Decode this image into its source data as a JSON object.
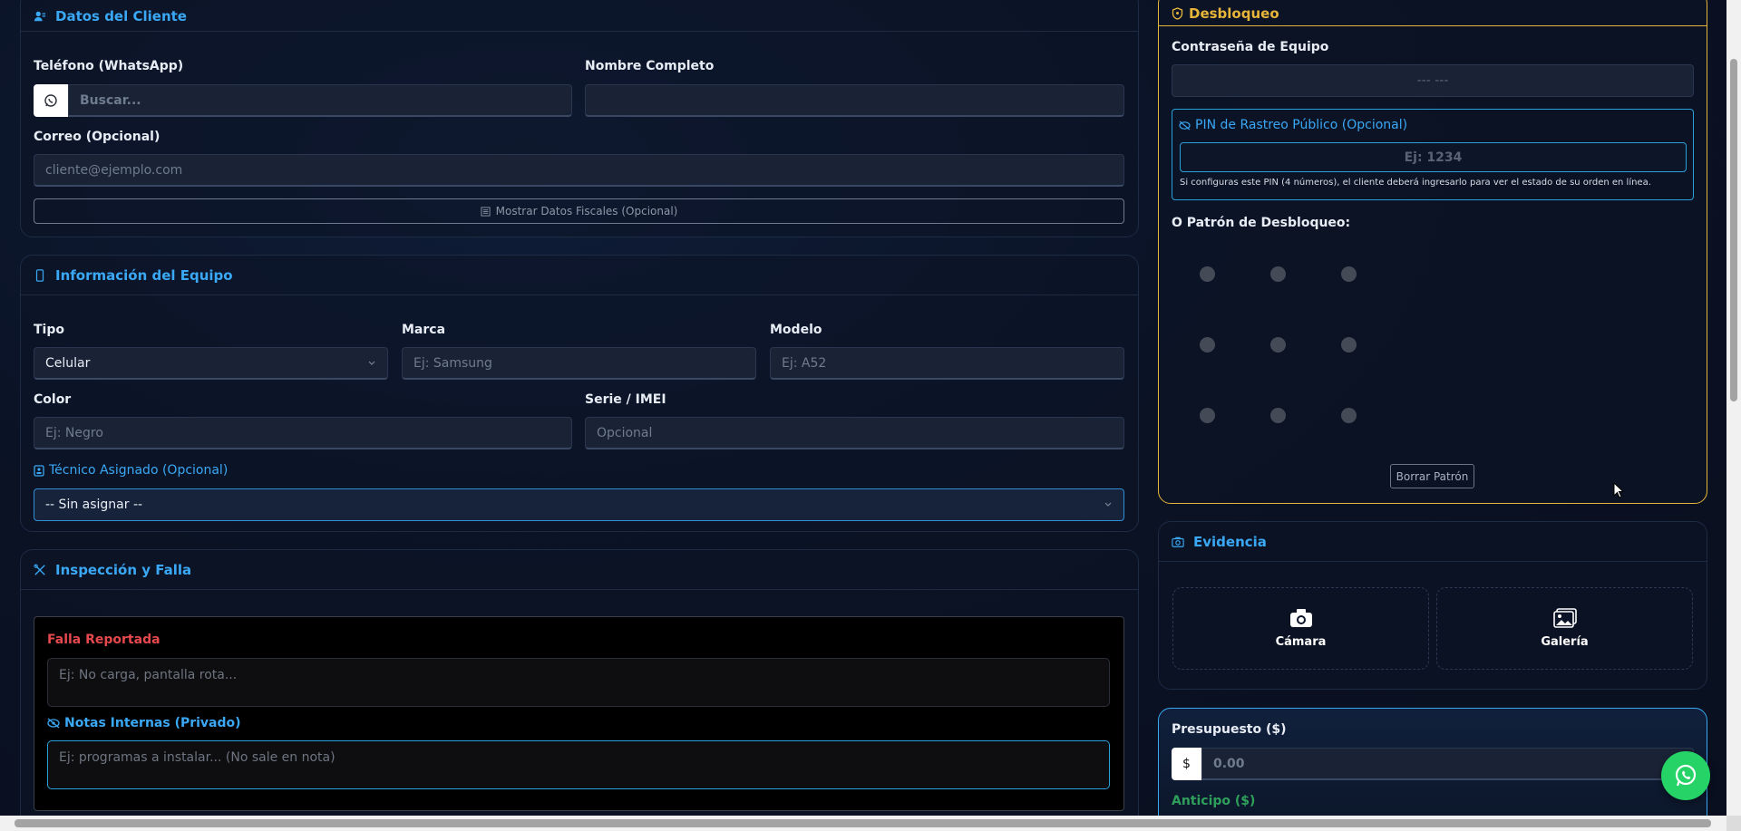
{
  "cliente": {
    "title": "Datos del Cliente",
    "telefono_label": "Teléfono (WhatsApp)",
    "telefono_placeholder": "Buscar...",
    "nombre_label": "Nombre Completo",
    "correo_label": "Correo (Opcional)",
    "correo_placeholder": "cliente@ejemplo.com",
    "fiscales_button": "Mostrar Datos Fiscales (Opcional)"
  },
  "equipo": {
    "title": "Información del Equipo",
    "tipo_label": "Tipo",
    "tipo_value": "Celular",
    "marca_label": "Marca",
    "marca_placeholder": "Ej: Samsung",
    "modelo_label": "Modelo",
    "modelo_placeholder": "Ej: A52",
    "color_label": "Color",
    "color_placeholder": "Ej: Negro",
    "serie_label": "Serie / IMEI",
    "serie_placeholder": "Opcional",
    "tecnico_label": "Técnico Asignado (Opcional)",
    "tecnico_value": "-- Sin asignar --"
  },
  "inspeccion": {
    "title": "Inspección y Falla",
    "falla_label": "Falla Reportada",
    "falla_placeholder": "Ej: No carga, pantalla rota...",
    "notas_label": "Notas Internas (Privado)",
    "notas_placeholder": "Ej: programas a instalar... (No sale en nota)"
  },
  "desbloqueo": {
    "title": "Desbloqueo",
    "contrasena_label": "Contraseña de Equipo",
    "contrasena_placeholder": "--- ---",
    "pin_label": "PIN de Rastreo Público (Opcional)",
    "pin_placeholder": "Ej: 1234",
    "pin_help": "Si configuras este PIN (4 números), el cliente deberá ingresarlo para ver el estado de su orden en línea.",
    "patron_label": "O Patrón de Desbloqueo:",
    "borrar_button": "Borrar Patrón"
  },
  "evidencia": {
    "title": "Evidencia",
    "camara_label": "Cámara",
    "galeria_label": "Galería"
  },
  "presupuesto": {
    "label": "Presupuesto ($)",
    "currency": "$",
    "placeholder": "0.00",
    "anticipo_label": "Anticipo ($)"
  },
  "icons": {
    "user": "user-icon",
    "phone": "phone-icon",
    "tools": "tools-icon",
    "shield": "shield-icon",
    "camera": "camera-icon",
    "whatsapp": "whatsapp-icon"
  },
  "colors": {
    "accent": "#3aa8f5",
    "gold": "#e7b53a",
    "danger": "#e5484d",
    "success": "#2ea05a",
    "whatsapp": "#25d366"
  }
}
